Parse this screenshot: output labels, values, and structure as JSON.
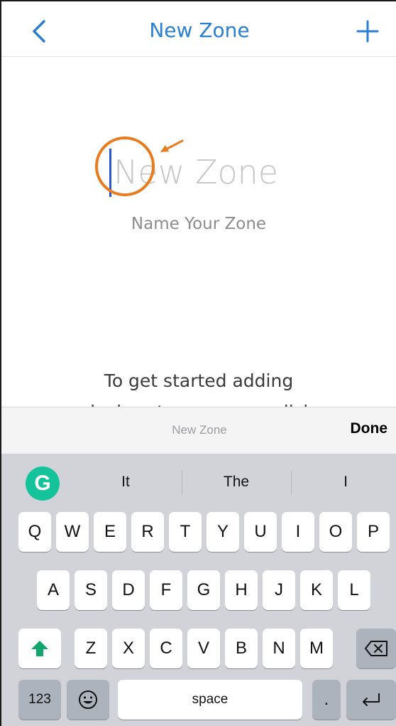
{
  "nav": {
    "title": "New Zone",
    "back_icon": "chevron-left-icon",
    "add_icon": "plus-icon",
    "accent_color": "#2a7fd4"
  },
  "zone_form": {
    "name_placeholder": "New Zone",
    "name_label": "Name Your Zone"
  },
  "help": {
    "line1": "To get started adding",
    "line2": "devices to your zone click"
  },
  "accessory": {
    "title": "New Zone",
    "done_label": "Done"
  },
  "keyboard": {
    "suggestions": [
      "It",
      "The",
      "I"
    ],
    "row1": [
      "Q",
      "W",
      "E",
      "R",
      "T",
      "Y",
      "U",
      "I",
      "O",
      "P"
    ],
    "row2": [
      "A",
      "S",
      "D",
      "F",
      "G",
      "H",
      "J",
      "K",
      "L"
    ],
    "row3": [
      "Z",
      "X",
      "C",
      "V",
      "B",
      "N",
      "M"
    ],
    "numbers_label": "123",
    "space_label": "space",
    "period_label": ".",
    "grammarly_letter": "G"
  }
}
